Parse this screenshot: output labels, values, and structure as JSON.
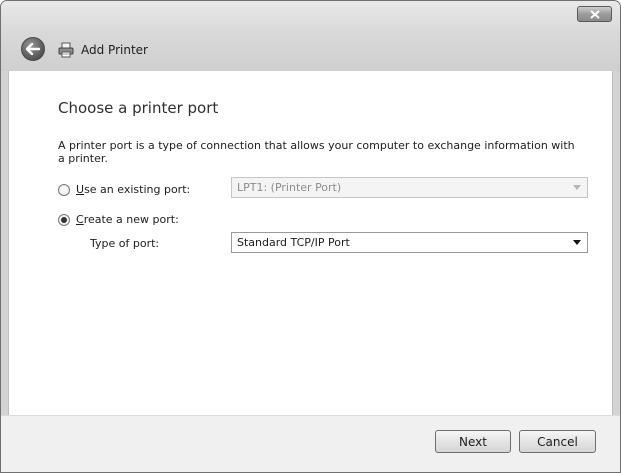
{
  "window": {
    "title": "Add Printer"
  },
  "page": {
    "heading": "Choose a printer port",
    "description": "A printer port is a type of connection that allows your computer to exchange information with a printer."
  },
  "options": {
    "existing_port": {
      "label_first": "U",
      "label_rest": "se an existing port:",
      "selected": false,
      "combo_value": "LPT1: (Printer Port)",
      "combo_enabled": false
    },
    "new_port": {
      "label_first": "C",
      "label_rest": "reate a new port:",
      "selected": true
    },
    "type_of_port": {
      "label": "Type of port:",
      "combo_value": "Standard TCP/IP Port"
    }
  },
  "buttons": {
    "next": "Next",
    "cancel": "Cancel"
  },
  "icons": {
    "back": "back-arrow-icon",
    "printer": "printer-icon",
    "close": "close-icon",
    "dropdown": "chevron-down-icon"
  }
}
